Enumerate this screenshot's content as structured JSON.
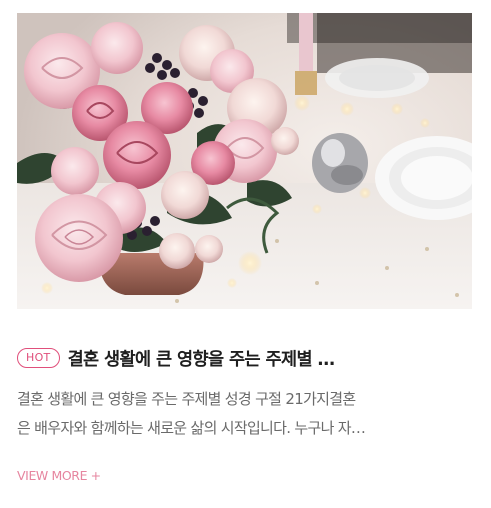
{
  "post": {
    "image_alt": "pink roses bouquet on a decorated dinner table",
    "badge": "HOT",
    "title": "결혼 생활에 큰 영향을 주는 주제별 …",
    "summary_line1": "결혼 생활에 큰 영향을 주는 주제별 성경 구절 21가지결혼",
    "summary_line2": "은 배우자와 함께하는 새로운 삶의 시작입니다. 누구나 자…",
    "more_label": "VIEW MORE +"
  },
  "colors": {
    "accent_pink": "#e04f7b",
    "more_link": "#e6859f",
    "title": "#1f1f1f",
    "summary": "#6a6a6a"
  }
}
